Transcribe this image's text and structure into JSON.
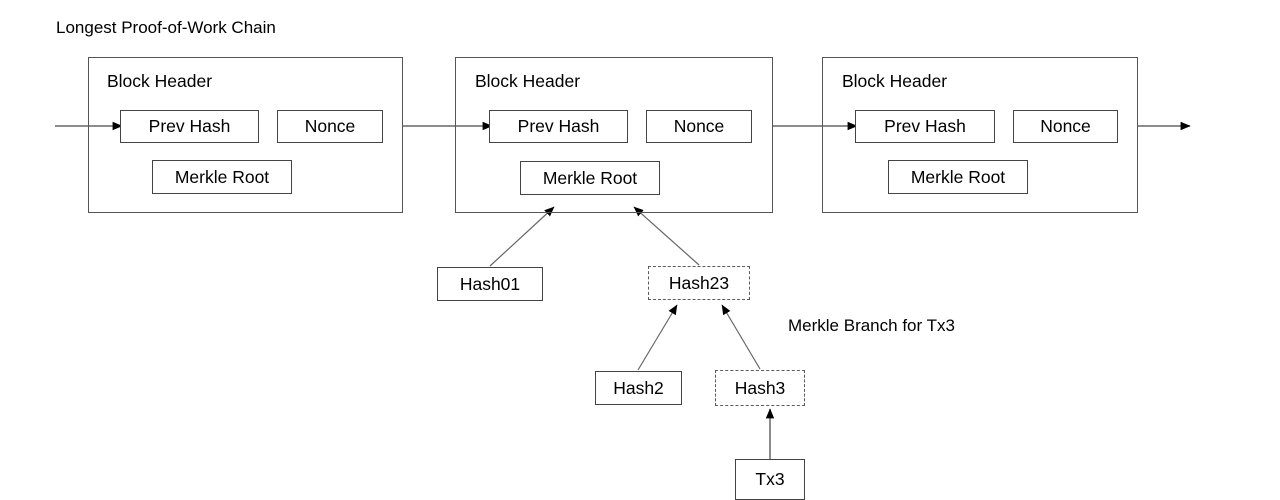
{
  "diagram": {
    "title": "Longest Proof-of-Work Chain",
    "caption": "Merkle Branch for Tx3",
    "field_labels": {
      "prev_hash": "Prev Hash",
      "nonce": "Nonce",
      "merkle_root": "Merkle Root"
    },
    "blocks": [
      {
        "label": "Block Header",
        "prev_hash": "Prev Hash",
        "nonce": "Nonce",
        "merkle_root": "Merkle Root"
      },
      {
        "label": "Block Header",
        "prev_hash": "Prev Hash",
        "nonce": "Nonce",
        "merkle_root": "Merkle Root"
      },
      {
        "label": "Block Header",
        "prev_hash": "Prev Hash",
        "nonce": "Nonce",
        "merkle_root": "Merkle Root"
      }
    ],
    "merkle_nodes": [
      {
        "label": "Hash01",
        "style": "solid"
      },
      {
        "label": "Hash23",
        "style": "dashed"
      },
      {
        "label": "Hash2",
        "style": "solid"
      },
      {
        "label": "Hash3",
        "style": "dashed"
      },
      {
        "label": "Tx3",
        "style": "solid"
      }
    ],
    "colors": {
      "stroke": "#555555",
      "inner_stroke": "#444444",
      "dashed_stroke": "#5a5a5a",
      "arrow_line": "#666666",
      "arrow_head": "#000000",
      "text": "#000000",
      "background": "#ffffff"
    }
  }
}
